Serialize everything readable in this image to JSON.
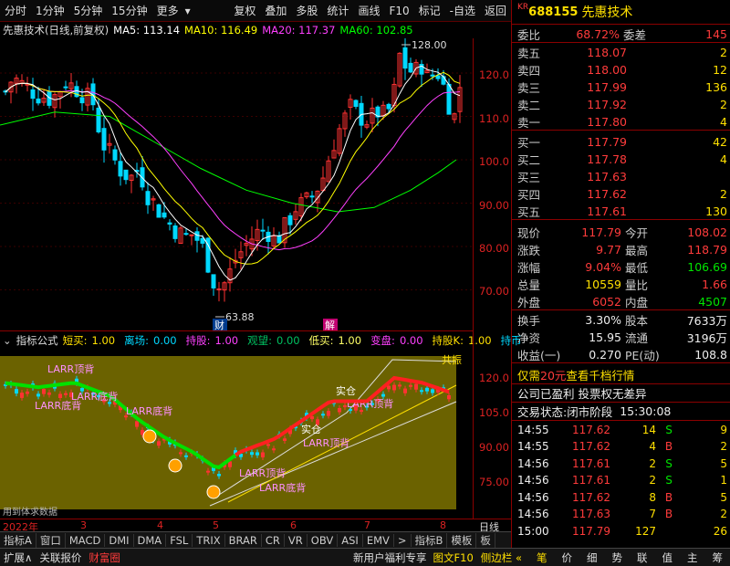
{
  "toolbar": {
    "left_items": [
      "分时",
      "1分钟",
      "5分钟",
      "15分钟",
      "更多"
    ],
    "right_items": [
      "复权",
      "叠加",
      "多股",
      "统计",
      "画线",
      "F10",
      "标记",
      "-自选",
      "返回"
    ]
  },
  "chart_info": {
    "name": "先惠技术(日线,前复权)",
    "ma5": "MA5: 113.14",
    "ma10": "MA10: 116.49",
    "ma20": "MA20: 117.37",
    "ma60": "MA60: 102.85",
    "high_marker": "128.00",
    "low_marker": "63.88",
    "event_a": "财",
    "event_b": "解",
    "colors": {
      "ma5": "#ffffff",
      "ma10": "#ffff00",
      "ma20": "#ff40ff",
      "ma60": "#00ff00",
      "up": "#ff3232",
      "down": "#00d8ff"
    }
  },
  "price_axis": [
    "120.0",
    "110.0",
    "100.0",
    "90.00",
    "80.00",
    "70.00"
  ],
  "indicator": {
    "title": "指标公式",
    "params": [
      {
        "label": "短买:",
        "value": "1.00"
      },
      {
        "label": "离场:",
        "value": "0.00"
      },
      {
        "label": "持股:",
        "value": "1.00"
      },
      {
        "label": "观望:",
        "value": "0.00"
      },
      {
        "label": "低买:",
        "value": "1.00"
      },
      {
        "label": "变盘:",
        "value": "0.00"
      },
      {
        "label": "持股K:",
        "value": "1.00"
      },
      {
        "label": "持币",
        "value": ""
      }
    ],
    "axis": [
      "120.0",
      "105.0",
      "90.00",
      "75.00"
    ],
    "labels": {
      "top_div": "LARR顶背",
      "bot_div": "LARR底背",
      "solid": "实仓",
      "cross": "共振",
      "watermark": "用到体求数据"
    }
  },
  "dates": [
    "2022年",
    "3",
    "4",
    "5",
    "6",
    "7",
    "8"
  ],
  "day_line": "日线",
  "bottom_tabs": [
    "指标A",
    "窗口",
    "MACD",
    "DMI",
    "DMA",
    "FSL",
    "TRIX",
    "BRAR",
    "CR",
    "VR",
    "OBV",
    "ASI",
    "EMV",
    ">",
    "指标B",
    "模板",
    "板"
  ],
  "bottom_bar": {
    "left": [
      "扩展∧",
      "关联报价",
      "财富圈"
    ],
    "promo": "新用户福利专享",
    "right": [
      "图文F10",
      "侧边栏 «"
    ],
    "icons": [
      "笔",
      "价",
      "细",
      "势",
      "联",
      "值",
      "主",
      "筹"
    ]
  },
  "quote": {
    "market": "KR",
    "code": "688155",
    "name": "先惠技术",
    "webi_label": "委比",
    "webi": "68.72%",
    "weicha_label": "委差",
    "weicha": "145",
    "asks": [
      {
        "label": "卖五",
        "price": "118.07",
        "vol": "2"
      },
      {
        "label": "卖四",
        "price": "118.00",
        "vol": "12"
      },
      {
        "label": "卖三",
        "price": "117.99",
        "vol": "136"
      },
      {
        "label": "卖二",
        "price": "117.92",
        "vol": "2"
      },
      {
        "label": "卖一",
        "price": "117.80",
        "vol": "4"
      }
    ],
    "bids": [
      {
        "label": "买一",
        "price": "117.79",
        "vol": "42"
      },
      {
        "label": "买二",
        "price": "117.78",
        "vol": "4"
      },
      {
        "label": "买三",
        "price": "117.63",
        "vol": ""
      },
      {
        "label": "买四",
        "price": "117.62",
        "vol": "2"
      },
      {
        "label": "买五",
        "price": "117.61",
        "vol": "130"
      }
    ],
    "stats": [
      {
        "l1": "现价",
        "v1": "117.79",
        "l2": "今开",
        "v2": "108.02",
        "c1": "red",
        "c2": "red"
      },
      {
        "l1": "涨跌",
        "v1": "9.77",
        "l2": "最高",
        "v2": "118.79",
        "c1": "red",
        "c2": "red"
      },
      {
        "l1": "涨幅",
        "v1": "9.04%",
        "l2": "最低",
        "v2": "106.69",
        "c1": "red",
        "c2": "grn"
      },
      {
        "l1": "总量",
        "v1": "10559",
        "l2": "量比",
        "v2": "1.66",
        "c1": "yel",
        "c2": "red"
      },
      {
        "l1": "外盘",
        "v1": "6052",
        "l2": "内盘",
        "v2": "4507",
        "c1": "red",
        "c2": "grn"
      }
    ],
    "stats2": [
      {
        "l1": "换手",
        "v1": "3.30%",
        "l2": "股本",
        "v2": "7633万"
      },
      {
        "l1": "净资",
        "v1": "15.95",
        "l2": "流通",
        "v2": "3196万"
      },
      {
        "l1": "收益(一)",
        "v1": "0.270",
        "l2": "PE(动)",
        "v2": "108.8"
      }
    ],
    "promo1_a": "仅需",
    "promo1_b": "20元",
    "promo1_c": "查看千档行情",
    "promo2": "公司已盈利 投票权无差异",
    "status_label": "交易状态:",
    "status": "闭市阶段",
    "status_time": "15:30:08",
    "ticks": [
      {
        "time": "14:55",
        "price": "117.62",
        "vol": "14",
        "side": "S"
      },
      {
        "time": "14:55",
        "price": "117.62",
        "vol": "4",
        "side": "B"
      },
      {
        "time": "14:56",
        "price": "117.61",
        "vol": "2",
        "side": "S"
      },
      {
        "time": "14:56",
        "price": "117.61",
        "vol": "2",
        "side": "S"
      },
      {
        "time": "14:56",
        "price": "117.62",
        "vol": "8",
        "side": "B"
      },
      {
        "time": "14:56",
        "price": "117.63",
        "vol": "7",
        "side": "B"
      },
      {
        "time": "15:00",
        "price": "117.79",
        "vol": "127",
        "side": ""
      }
    ],
    "tick_counts": [
      "9",
      "2",
      "5",
      "1",
      "5",
      "2",
      "26"
    ]
  }
}
